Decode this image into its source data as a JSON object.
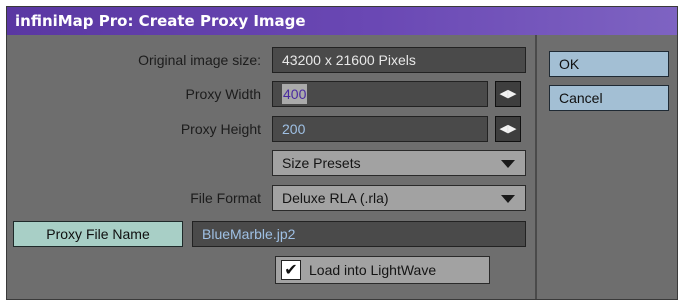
{
  "window": {
    "title": "infiniMap Pro: Create Proxy Image"
  },
  "original_size": {
    "label": "Original image size:",
    "value": "43200 x 21600 Pixels"
  },
  "proxy_width": {
    "label": "Proxy Width",
    "value": "400",
    "stepper_icon": "left-right-arrows-icon"
  },
  "proxy_height": {
    "label": "Proxy Height",
    "value": "200",
    "stepper_icon": "left-right-arrows-icon"
  },
  "size_presets": {
    "value": "Size Presets"
  },
  "file_format": {
    "label": "File Format",
    "value": "Deluxe RLA (.rla)"
  },
  "proxy_file_name": {
    "button_label": "Proxy File Name",
    "value": "BlueMarble.jp2"
  },
  "load_into_lightwave": {
    "label": "Load into LightWave",
    "checked": true
  },
  "buttons": {
    "ok": "OK",
    "cancel": "Cancel"
  },
  "colors": {
    "title_bar": "#5a37a2",
    "panel": "#6e6e6e",
    "button": "#a3bfd4",
    "text_value": "#9fc0e4"
  }
}
